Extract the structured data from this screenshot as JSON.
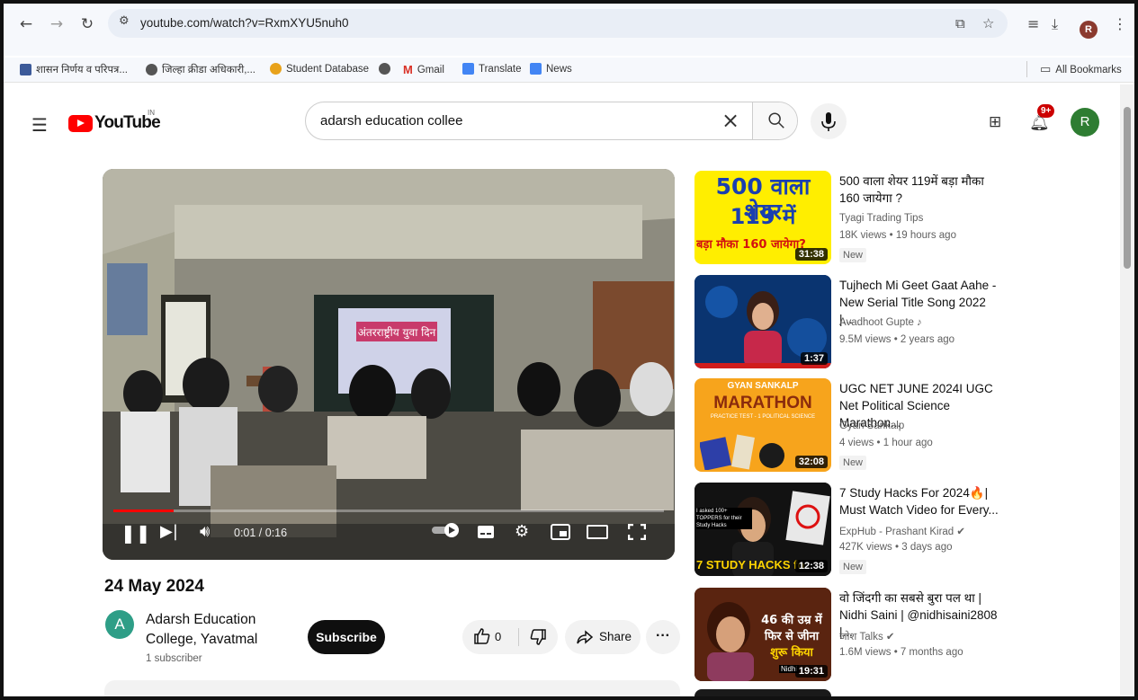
{
  "browser": {
    "url": "youtube.com/watch?v=RxmXYU5nuh0",
    "profile_initial": "R",
    "bookmarks": [
      {
        "label": "शासन निर्णय व परिपत्र...",
        "color": "#3c5a99"
      },
      {
        "label": "जिल्हा क्रीडा अधिकारी,...",
        "color": "#555555"
      },
      {
        "label": "Student Database",
        "color": "#e8a21b"
      },
      {
        "label": "",
        "color": "#555555"
      },
      {
        "label": "Gmail",
        "color": "#d93025"
      },
      {
        "label": "Translate",
        "color": "#4285f4"
      },
      {
        "label": "News",
        "color": "#4285f4"
      }
    ],
    "all_bookmarks_label": "All Bookmarks"
  },
  "youtube": {
    "logo_text": "YouTube",
    "country": "IN",
    "search_value": "adarsh education collee",
    "notification_count": "9+",
    "avatar_initial": "R"
  },
  "player": {
    "time_display": "0:01 / 0:16",
    "progress": 0.11,
    "overlay_text": "अंतरराष्ट्रीय युवा दिन"
  },
  "video": {
    "title": "24 May 2024",
    "channel_initial": "A",
    "channel_name": "Adarsh Education College, Yavatmal",
    "subscribers": "1 subscriber",
    "subscribe_label": "Subscribe",
    "like_count": "0",
    "share_label": "Share",
    "more_label": "···"
  },
  "recommendations": [
    {
      "title": "500 वाला शेयर 119में बड़ा मौका 160 जायेगा ?",
      "channel": "Tyagi Trading Tips",
      "meta": "18K views • 19 hours ago",
      "badge": "New",
      "duration": "31:38",
      "thumb_lines": [
        "500 वाला शेयर",
        "119 में",
        "बड़ा मौका 160 जायेगा?"
      ]
    },
    {
      "title": "Tujhech Mi Geet Gaat Aahe - New Serial Title Song 2022 |...",
      "channel": "Avadhoot Gupte ♪",
      "meta": "9.5M views • 2 years ago",
      "badge": "",
      "duration": "1:37",
      "thumb_lines": []
    },
    {
      "title": "UGC NET JUNE 2024I UGC Net Political Science Marathon...",
      "channel": "Gyan Sankalp",
      "meta": "4 views • 1 hour ago",
      "badge": "New",
      "duration": "32:08",
      "thumb_lines": [
        "GYAN SANKALP",
        "MARATHON",
        "PRACTICE TEST - 1 POLITICAL SCIENCE"
      ]
    },
    {
      "title": "7 Study Hacks For 2024🔥| Must Watch Video for Every...",
      "channel": "ExpHub - Prashant Kirad ✔",
      "meta": "427K views • 3 days ago",
      "badge": "New",
      "duration": "12:38",
      "thumb_lines": [
        "I asked 100+ TOPPERS for their Study Hacks",
        "7 STUDY HACKS for 2024"
      ]
    },
    {
      "title": "वो जिंदगी का सबसे बुरा पल था | Nidhi Saini | @nidhisaini2808 |...",
      "channel": "जोश Talks ✔",
      "meta": "1.6M views • 7 months ago",
      "badge": "",
      "duration": "19:31",
      "thumb_lines": [
        "46 की उम्र में",
        "फिर से जीना",
        "शुरू किया",
        "Nidhi"
      ]
    }
  ]
}
